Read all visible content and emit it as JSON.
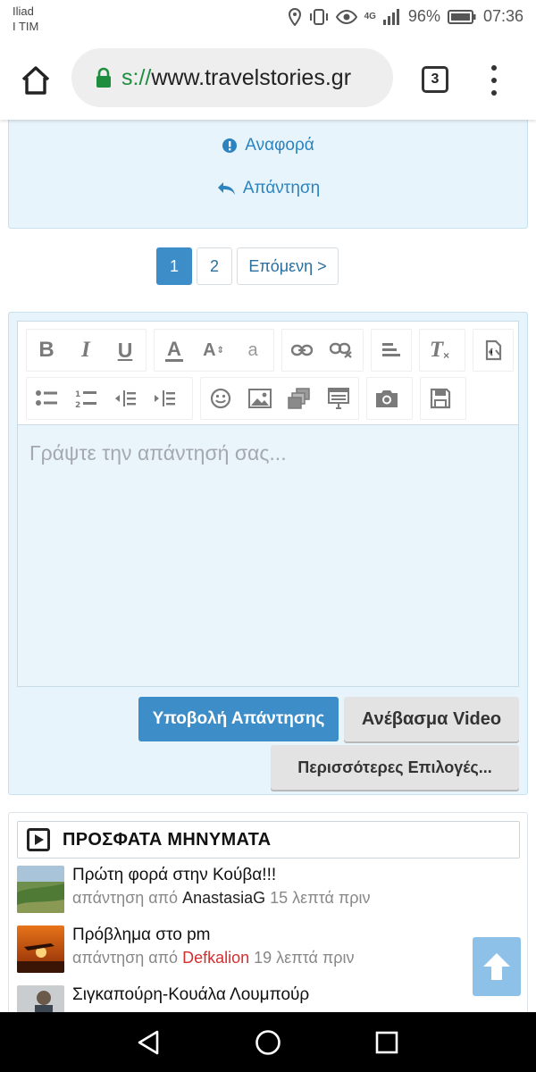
{
  "status_bar": {
    "carrier_line1": "Iliad",
    "carrier_line2": "I TIM",
    "network": "4G",
    "battery": "96%",
    "time": "07:36"
  },
  "browser": {
    "url_scheme": "s://",
    "url_host": "www.travelstories.gr",
    "tab_count": "3"
  },
  "post_actions": {
    "report_label": "Αναφορά",
    "reply_label": "Απάντηση"
  },
  "pagination": {
    "pages": [
      "1",
      "2"
    ],
    "current": "1",
    "next_label": "Επόμενη >"
  },
  "editor": {
    "toolbar_icons": [
      "bold-icon",
      "italic-icon",
      "underline-icon",
      "font-color-icon",
      "font-size-icon",
      "font-face-icon",
      "link-icon",
      "unlink-icon",
      "align-icon",
      "remove-format-icon",
      "source-icon",
      "bullet-list-icon",
      "numbered-list-icon",
      "outdent-icon",
      "indent-icon",
      "emoticon-icon",
      "image-icon",
      "gallery-icon",
      "table-icon",
      "camera-icon",
      "save-icon"
    ],
    "bold_glyph": "B",
    "italic_glyph": "I",
    "underline_glyph": "U",
    "font_color_glyph": "A",
    "font_size_glyph": "A",
    "font_face_glyph": "a",
    "remove_format_glyph": "T",
    "placeholder": "Γράψτε την απάντησή σας...",
    "submit_label": "Υποβολή Απάντησης",
    "video_label": "Ανέβασμα Video",
    "more_label": "Περισσότερες Επιλογές..."
  },
  "recent": {
    "title": "ΠΡΟΣΦΑΤΑ ΜΗΝΥΜΑΤΑ",
    "items": [
      {
        "title": "Πρώτη φορά στην Κούβα!!!",
        "prefix": "απάντηση από",
        "user": "AnastasiaG",
        "time": "15 λεπτά πριν"
      },
      {
        "title": "Πρόβλημα στο pm",
        "prefix": "απάντηση από",
        "user": "Defkalion",
        "time": "19 λεπτά πριν"
      },
      {
        "title": "Σιγκαπούρη-Κουάλα Λουμπούρ",
        "prefix": "",
        "user": "",
        "time": ""
      }
    ]
  },
  "colors": {
    "accent": "#3d8dc9",
    "panel_bg": "#e8f4fc",
    "link": "#2b84c0",
    "user_red": "#d32f2f"
  }
}
